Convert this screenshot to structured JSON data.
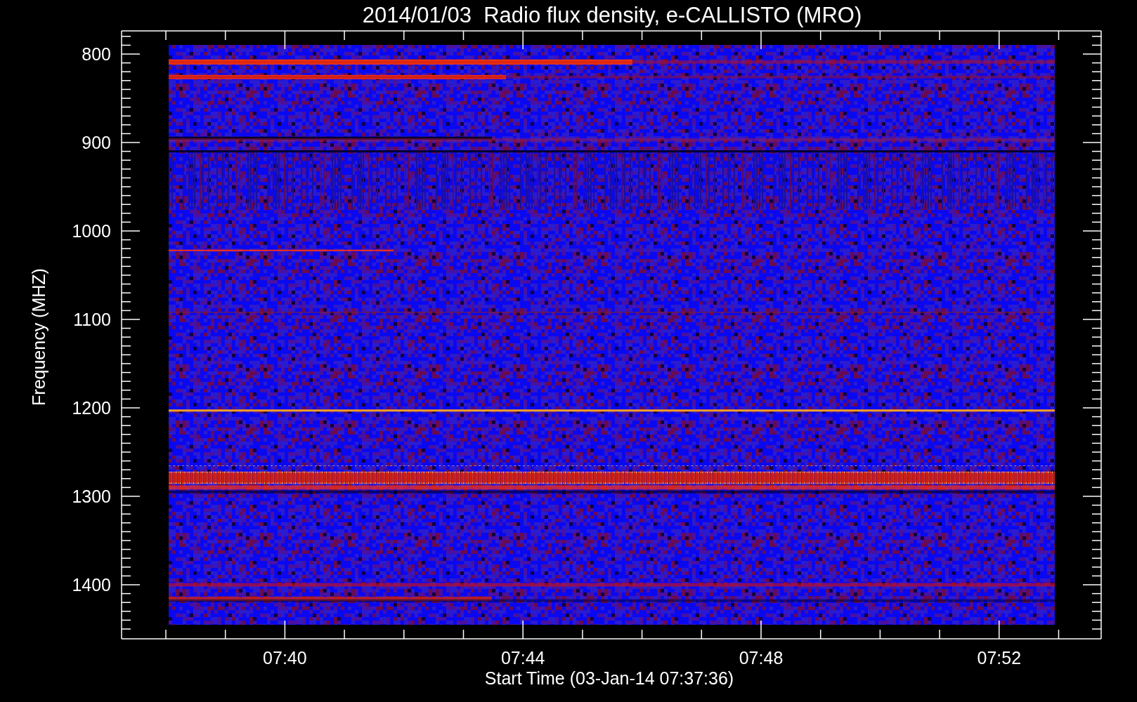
{
  "title": "2014/01/03  Radio flux density, e-CALLISTO (MRO)",
  "y_axis": {
    "label": "Frequency (MHZ)",
    "ticks": [
      "800",
      "900",
      "1000",
      "1100",
      "1200",
      "1300",
      "1400"
    ]
  },
  "x_axis": {
    "label": "Start Time (03-Jan-14 07:37:36)",
    "ticks": [
      "07:40",
      "07:44",
      "07:48",
      "07:52"
    ]
  }
}
